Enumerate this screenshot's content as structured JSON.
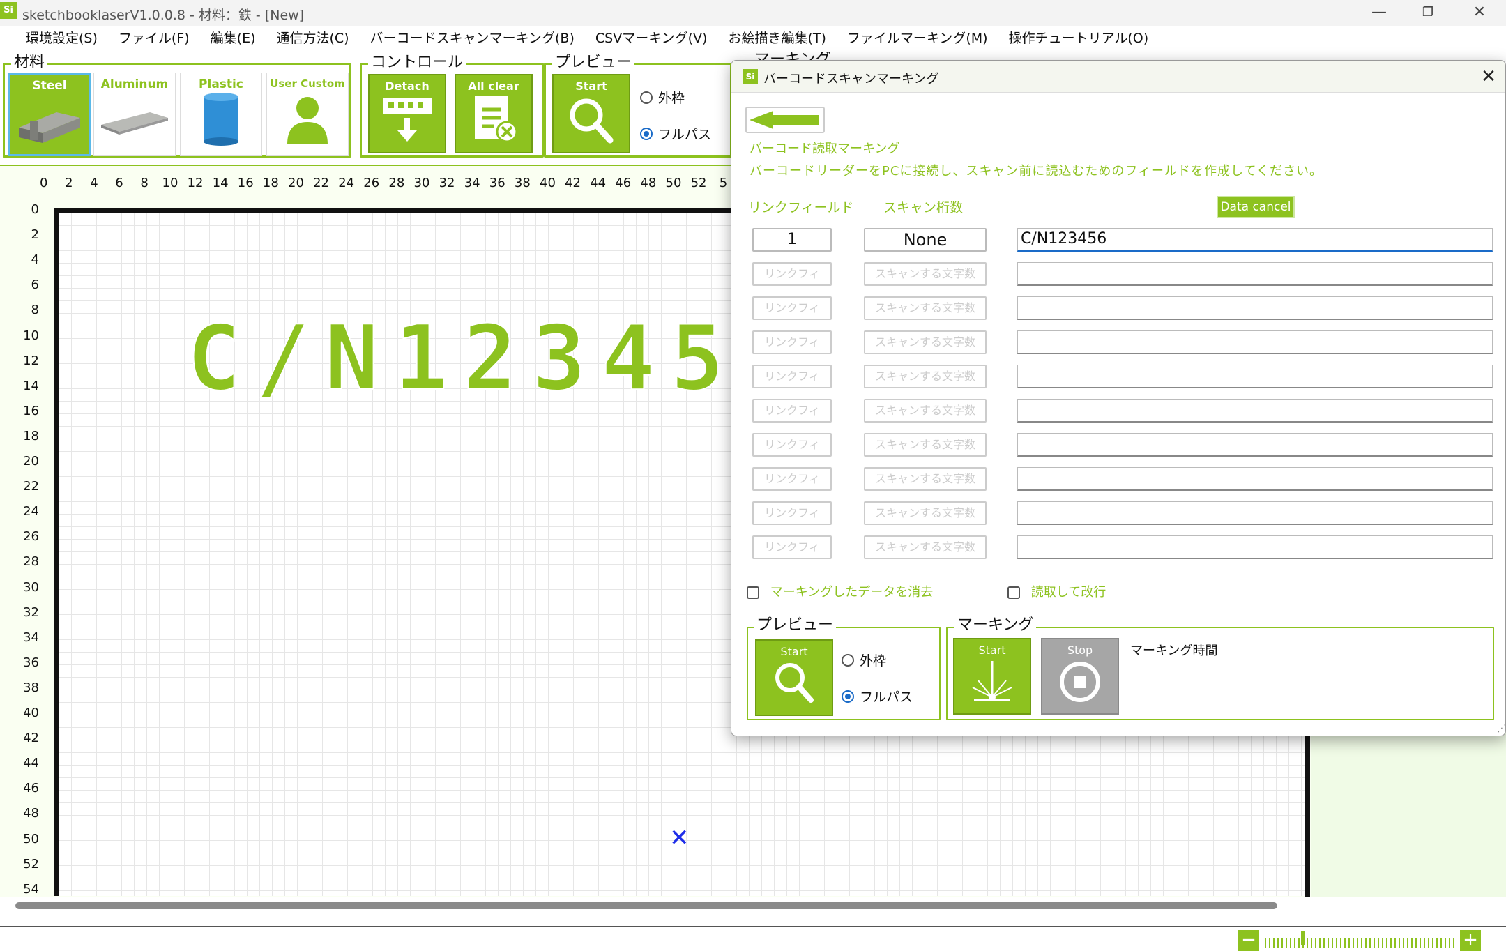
{
  "window": {
    "title": "sketchbooklaserV1.0.0.8 - 材料：鉄 - [New]",
    "logo": "Si",
    "controls": [
      "minimize-icon",
      "restore-icon",
      "close-icon"
    ]
  },
  "menu": [
    "環境設定(S)",
    "ファイル(F)",
    "編集(E)",
    "通信方法(C)",
    "バーコードスキャンマーキング(B)",
    "CSVマーキング(V)",
    "お絵描き編集(T)",
    "ファイルマーキング(M)",
    "操作チュートリアル(O)"
  ],
  "materials": {
    "label": "材料",
    "items": [
      "Steel",
      "Aluminum",
      "Plastic",
      "User Custom"
    ],
    "selected": "Steel"
  },
  "control": {
    "label": "コントロール",
    "detach": "Detach",
    "all_clear": "All clear"
  },
  "preview": {
    "label": "プレビュー",
    "start": "Start",
    "outer": "外枠",
    "fullpath": "フルパス",
    "selected": "フルパス"
  },
  "marking_partial": "マーキング",
  "ruler": {
    "x": [
      "0",
      "2",
      "4",
      "6",
      "8",
      "10",
      "12",
      "14",
      "16",
      "18",
      "20",
      "22",
      "24",
      "26",
      "28",
      "30",
      "32",
      "34",
      "36",
      "38",
      "40",
      "42",
      "44",
      "46",
      "48",
      "50",
      "52",
      "5"
    ],
    "y": [
      "0",
      "2",
      "4",
      "6",
      "8",
      "10",
      "12",
      "14",
      "16",
      "18",
      "20",
      "22",
      "24",
      "26",
      "28",
      "30",
      "32",
      "34",
      "36",
      "38",
      "40",
      "42",
      "44",
      "46",
      "48",
      "50",
      "52",
      "54"
    ]
  },
  "canvas_text": "C/N123456",
  "colors": {
    "accent": "#8dc21f",
    "selection": "#5bb9e8",
    "marker": "#1f2ee8"
  },
  "dialog": {
    "logo": "Si",
    "title": "バーコードスキャンマーキング",
    "heading": "バーコード読取マーキング",
    "instruction": "バーコードリーダーをPCに接続し、スキャン前に読込むためのフィールドを作成してください。",
    "col_link": "リンクフィールド",
    "col_digits": "スキャン桁数",
    "data_cancel": "Data cancel",
    "rows": [
      {
        "link": "1",
        "digits": "None",
        "text": "C/N123456"
      },
      {
        "link": "リンクフィ",
        "digits": "スキャンする文字数",
        "text": ""
      },
      {
        "link": "リンクフィ",
        "digits": "スキャンする文字数",
        "text": ""
      },
      {
        "link": "リンクフィ",
        "digits": "スキャンする文字数",
        "text": ""
      },
      {
        "link": "リンクフィ",
        "digits": "スキャンする文字数",
        "text": ""
      },
      {
        "link": "リンクフィ",
        "digits": "スキャンする文字数",
        "text": ""
      },
      {
        "link": "リンクフィ",
        "digits": "スキャンする文字数",
        "text": ""
      },
      {
        "link": "リンクフィ",
        "digits": "スキャンする文字数",
        "text": ""
      },
      {
        "link": "リンクフィ",
        "digits": "スキャンする文字数",
        "text": ""
      },
      {
        "link": "リンクフィ",
        "digits": "スキャンする文字数",
        "text": ""
      }
    ],
    "chk_clear": "マーキングしたデータを消去",
    "chk_newline": "読取して改行",
    "preview_label": "プレビュー",
    "preview_start": "Start",
    "preview_outer": "外枠",
    "preview_fullpath": "フルパス",
    "marking_label": "マーキング",
    "marking_start": "Start",
    "marking_stop": "Stop",
    "marking_time": "マーキング時間"
  }
}
